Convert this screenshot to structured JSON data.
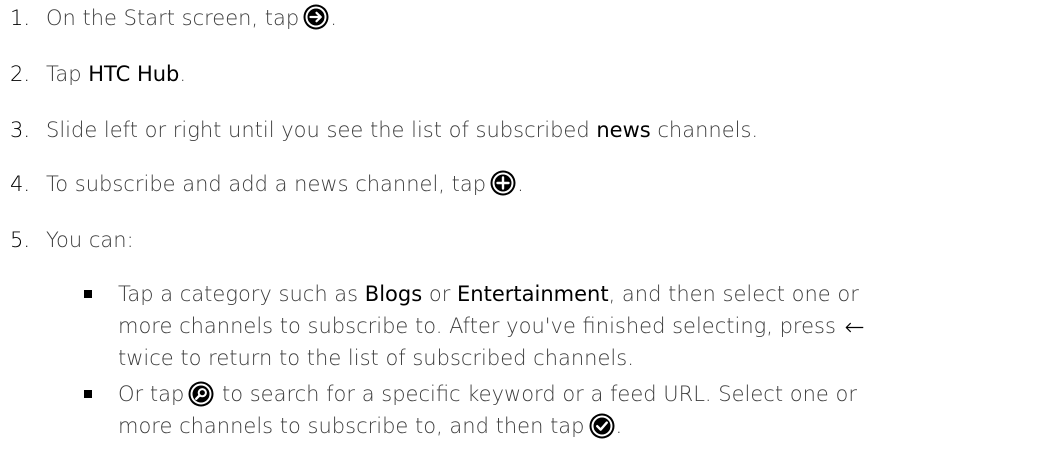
{
  "steps": [
    {
      "num": "1.",
      "pre": "On the Start screen, tap",
      "icon": "arrow-right-circle-icon",
      "post": "."
    },
    {
      "num": "2.",
      "pre": "Tap ",
      "bold": "HTC Hub",
      "post": "."
    },
    {
      "num": "3.",
      "pre": "Slide left or right until you see the list of subscribed ",
      "bold": "news",
      "post": " channels."
    },
    {
      "num": "4.",
      "pre": "To subscribe and add a news channel, tap",
      "icon": "plus-circle-icon",
      "post": "."
    },
    {
      "num": "5.",
      "pre": "You can:"
    }
  ],
  "bullets": [
    {
      "line1_pre": "Tap a category such as ",
      "bold1": "Blogs",
      "mid": " or ",
      "bold2": "Entertainment",
      "line1_post": ", and then select one or",
      "line2": "more channels to subscribe to. After you've finished selecting, press",
      "back_glyph": "←",
      "line3": "twice to return to the list of subscribed channels."
    },
    {
      "line1_pre": "Or tap",
      "icon1": "search-circle-icon",
      "line1_post": "to search for a specific keyword or a feed URL. Select one or",
      "line2_pre": "more channels to subscribe to, and then tap",
      "icon2": "check-circle-icon",
      "line2_post": "."
    }
  ]
}
